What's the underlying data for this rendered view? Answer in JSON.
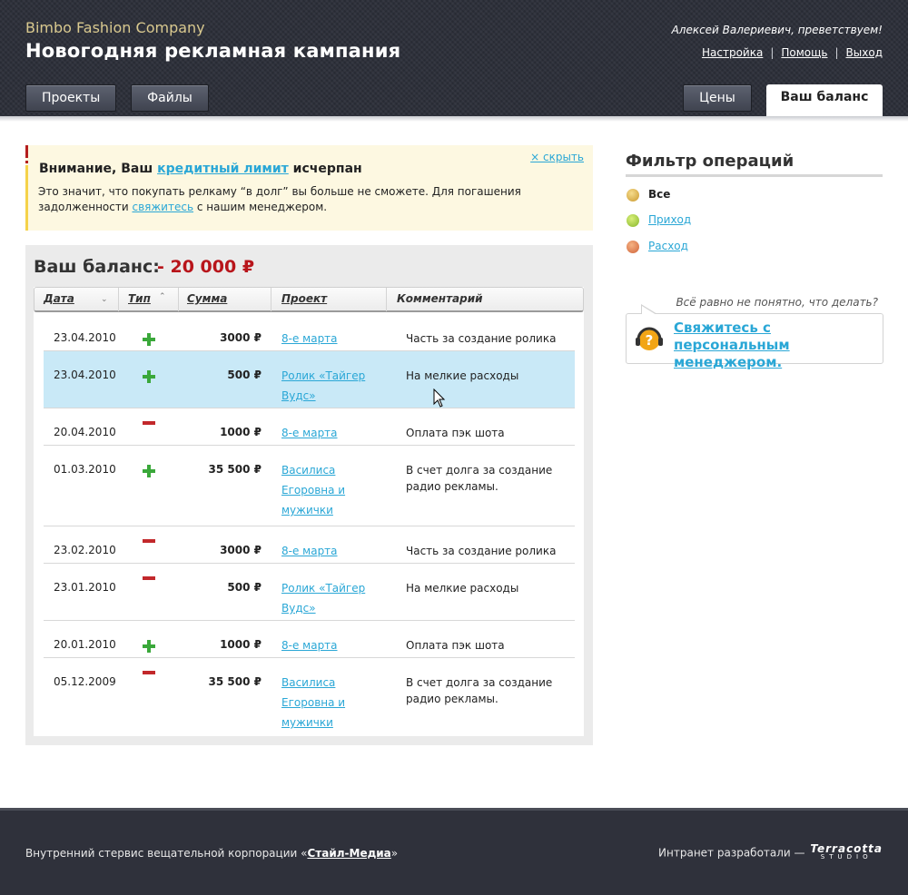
{
  "header": {
    "company": "Bimbo Fashion Company",
    "campaign": "Новогодняя рекламная кампания",
    "greeting": "Алексей Валериевич, преветствуем!",
    "links": [
      {
        "label": "Настройка"
      },
      {
        "label": "Помощь"
      },
      {
        "label": "Выход"
      }
    ],
    "separator": "|",
    "nav": {
      "projects": "Проекты",
      "files": "Файлы",
      "prices": "Цены",
      "balance_tab": "Ваш баланс"
    }
  },
  "warning": {
    "title_prefix": "Внимание, Ваш ",
    "title_link": "кредитный лимит",
    "title_suffix": " исчерпан",
    "text": "Это значит, что покупать релкаму “в долг” вы больше не сможете. Для погашения задолженности ",
    "text_link": "свяжитесь",
    "text_suffix": " с нашим менеджером.",
    "hide": "× скрыть"
  },
  "balance": {
    "label": "Ваш баланс:",
    "value": "- 20 000 ₽"
  },
  "table": {
    "columns": {
      "date": "Дата",
      "type": "Тип",
      "sum": "Сумма",
      "project": "Проект",
      "comment": "Комментарий"
    },
    "rows": [
      {
        "date": "23.04.2010",
        "type": "plus",
        "sum": "3000 ₽",
        "project": "8-е марта",
        "comment": "Часть за создание ролика"
      },
      {
        "date": "23.04.2010",
        "type": "plus",
        "sum": "500 ₽",
        "project": "Ролик «Тайгер Вудс»",
        "comment": "На мелкие расходы"
      },
      {
        "date": "20.04.2010",
        "type": "minus",
        "sum": "1000 ₽",
        "project": "8-е марта",
        "comment": "Оплата пэк шота"
      },
      {
        "date": "01.03.2010",
        "type": "plus",
        "sum": "35 500 ₽",
        "project": "Василиса Егоровна и мужички",
        "comment": "В счет долга за создание радио рекламы."
      },
      {
        "date": "23.02.2010",
        "type": "minus",
        "sum": "3000 ₽",
        "project": "8-е марта",
        "comment": "Часть за создание ролика"
      },
      {
        "date": "23.01.2010",
        "type": "minus",
        "sum": "500 ₽",
        "project": "Ролик «Тайгер Вудс»",
        "comment": "На мелкие расходы"
      },
      {
        "date": "20.01.2010",
        "type": "plus",
        "sum": "1000 ₽",
        "project": "8-е марта",
        "comment": "Оплата пэк шота"
      },
      {
        "date": "05.12.2009",
        "type": "minus",
        "sum": "35 500 ₽",
        "project": "Василиса Егоровна и мужички",
        "comment": "В счет долга за создание радио рекламы."
      }
    ],
    "selected_row": 1
  },
  "filter": {
    "title": "Фильтр операций",
    "all": "Все",
    "income": "Приход",
    "expense": "Расход"
  },
  "help": {
    "question": "Всё равно не понятно, что делать?",
    "link": "Свяжитесь с персональным менеджером."
  },
  "footer": {
    "left_prefix": "Внутренний стервис вещательной корпорации «",
    "left_link": "Стайл-Медиа",
    "left_suffix": "»",
    "right_prefix": "Интранет разработали — ",
    "brand": "Terracotta",
    "brand_sub": "STUDIO"
  },
  "colors": {
    "link": "#2aa7d6",
    "negative": "#b8151b",
    "plus": "#3aa83a",
    "minus": "#c2282b",
    "selected_row": "#c9e9f7"
  }
}
